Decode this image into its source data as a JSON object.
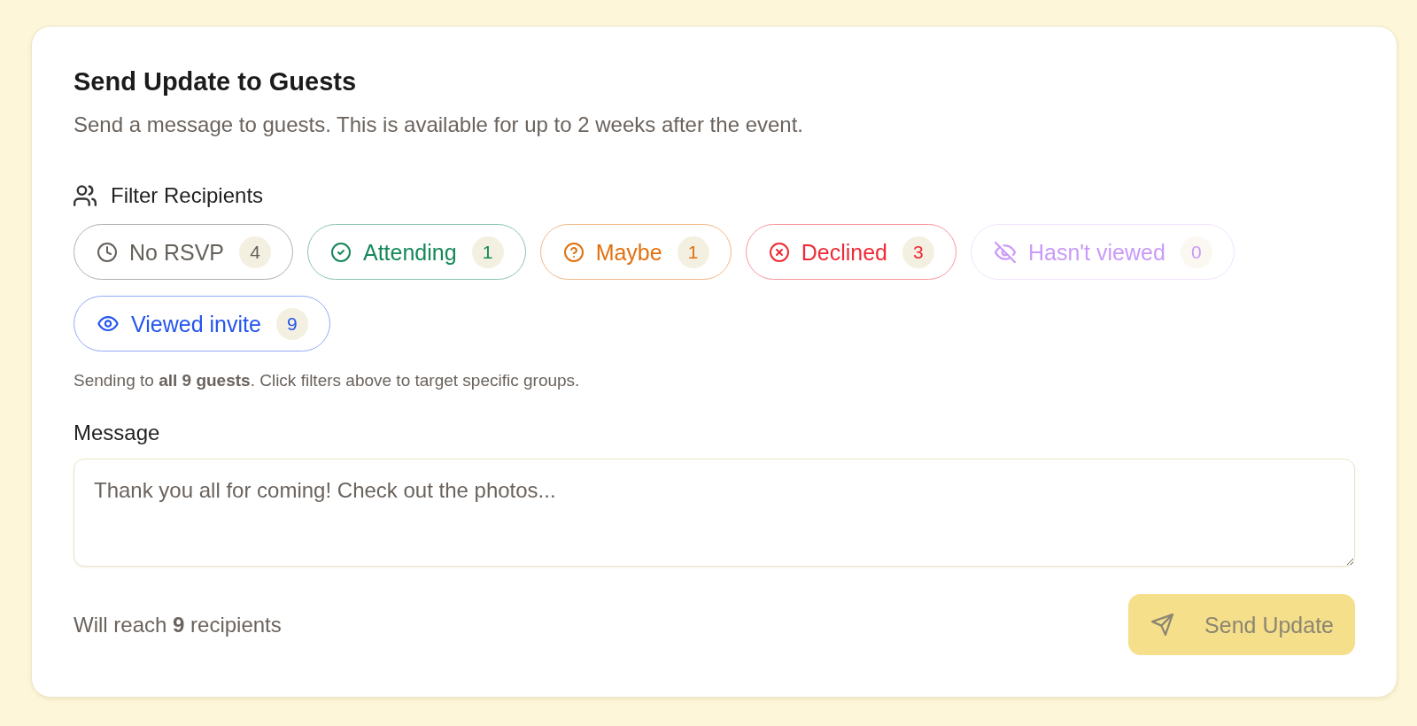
{
  "card": {
    "title": "Send Update to Guests",
    "description": "Send a message to guests. This is available for up to 2 weeks after the event."
  },
  "filter_section": {
    "label": "Filter Recipients"
  },
  "filters": [
    {
      "label": "No RSVP",
      "count": "4",
      "color": "#65605a",
      "selected": false,
      "disabled": false
    },
    {
      "label": "Attending",
      "count": "1",
      "color": "#16885a",
      "selected": false,
      "disabled": false
    },
    {
      "label": "Maybe",
      "count": "1",
      "color": "#e2700f",
      "selected": false,
      "disabled": false
    },
    {
      "label": "Declined",
      "count": "3",
      "color": "#ee2b36",
      "selected": false,
      "disabled": false
    },
    {
      "label": "Hasn't viewed",
      "count": "0",
      "color": "#c99af8",
      "selected": false,
      "disabled": true
    },
    {
      "label": "Viewed invite",
      "count": "9",
      "color": "#2455ee",
      "selected": false,
      "disabled": false
    }
  ],
  "hint": "Sending to **all 9 guests**. Click filters above to target specific groups.",
  "message": {
    "label": "Message",
    "placeholder": "Thank you all for coming! Check out the photos..."
  },
  "footer": {
    "reach": "Will reach **9** recipients",
    "send_button": {
      "label": "Send Update",
      "disabled": true
    }
  }
}
